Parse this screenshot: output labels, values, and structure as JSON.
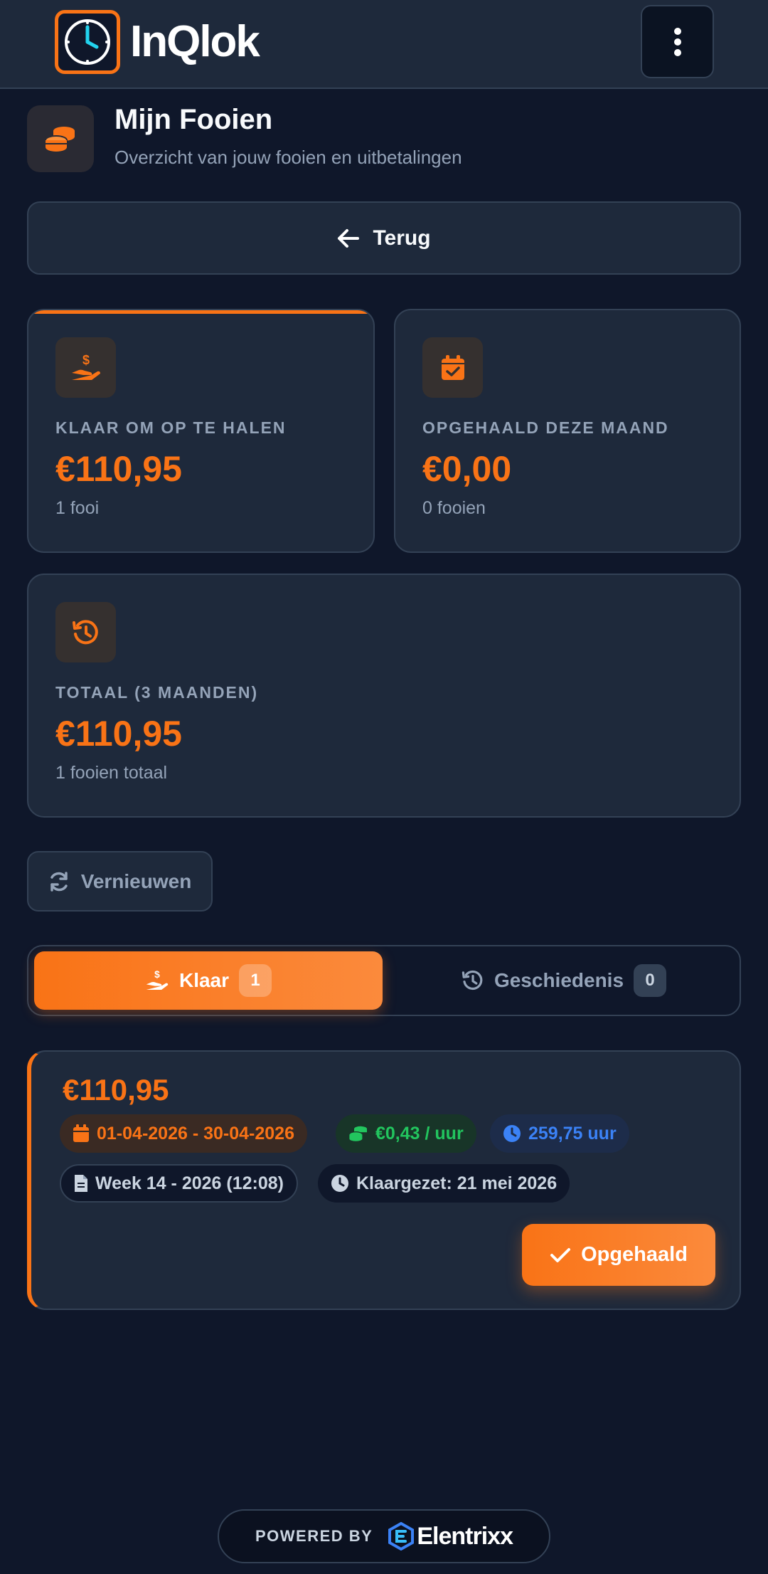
{
  "header": {
    "logo_text_a": "InQ",
    "logo_text_b": "lok",
    "menu_icon": "more-vertical-icon"
  },
  "page": {
    "title": "Mijn Fooien",
    "subtitle": "Overzicht van jouw fooien en uitbetalingen",
    "icon": "coins-icon"
  },
  "back_button": {
    "label": "Terug",
    "icon": "arrow-left-icon"
  },
  "stats": {
    "ready": {
      "label": "KLAAR OM OP TE HALEN",
      "value": "€110,95",
      "note": "1 fooi",
      "icon": "hand-dollar-icon"
    },
    "month": {
      "label": "OPGEHAALD DEZE MAAND",
      "value": "€0,00",
      "note": "0 fooien",
      "icon": "calendar-check-icon"
    },
    "total": {
      "label": "TOTAAL (3 MAANDEN)",
      "value": "€110,95",
      "note": "1 fooien totaal",
      "icon": "history-icon"
    }
  },
  "refresh_button": {
    "label": "Vernieuwen",
    "icon": "refresh-icon"
  },
  "tabs": {
    "ready": {
      "label": "Klaar",
      "count": "1",
      "icon": "hand-dollar-icon"
    },
    "history": {
      "label": "Geschiedenis",
      "count": "0",
      "icon": "history-icon"
    }
  },
  "tip": {
    "amount": "€110,95",
    "period": "01-04-2026 - 30-04-2026",
    "rate": "€0,43 / uur",
    "hours": "259,75 uur",
    "week": "Week 14 - 2026 (12:08)",
    "ready_at": "Klaargezet: 21 mei 2026",
    "action_label": "Opgehaald"
  },
  "footer": {
    "powered_by": "POWERED BY",
    "brand": "Elentrixx"
  },
  "colors": {
    "accent": "#f97316",
    "background": "#0f172a",
    "card": "#1e293b",
    "green": "#22c55e",
    "blue": "#3b82f6"
  }
}
